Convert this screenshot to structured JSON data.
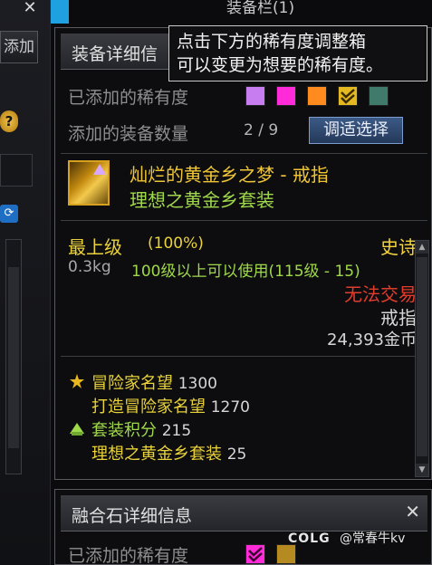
{
  "background": {
    "top_title": "装备栏(1)",
    "add_button": "添加",
    "help": "?"
  },
  "panel": {
    "title": "装备详细信",
    "rarity_label": "已添加的稀有度",
    "rarity_swatches": [
      "#c77df0",
      "#ff2bd8",
      "#ff8a1e",
      "#e3b820",
      "#3f7a6a"
    ],
    "count_label": "添加的装备数量",
    "count_value": "2 / 9",
    "choose_button": "调适选择"
  },
  "tooltip": {
    "line1": "点击下方的稀有度调整箱",
    "line2": "可以变更为想要的稀有度。"
  },
  "item": {
    "icon": "golden-ring-icon",
    "name": "灿烂的黄金乡之梦 - 戒指",
    "set_name": "理想之黄金乡套装",
    "grade": "最上级",
    "grade_pct": "(100%)",
    "rarity": "史诗",
    "weight": "0.3kg",
    "level_req": "100级以上可以使用(115级 - 15)",
    "trade": "无法交易",
    "type": "戒指",
    "price": "24,393金币",
    "stats": [
      {
        "label": "冒险家名望",
        "value": "1300"
      },
      {
        "label": "打造冒险家名望",
        "value": "1270"
      },
      {
        "label": "套装积分",
        "value": "215"
      },
      {
        "label": "理想之黄金乡套装",
        "value": "25"
      }
    ]
  },
  "panel2": {
    "title": "融合石详细信息",
    "rarity_label": "已添加的稀有度",
    "swatches": [
      "#ff2bd8",
      "#b58a20"
    ]
  },
  "watermark": {
    "logo": "COLG",
    "author": "@常春牛kv"
  }
}
